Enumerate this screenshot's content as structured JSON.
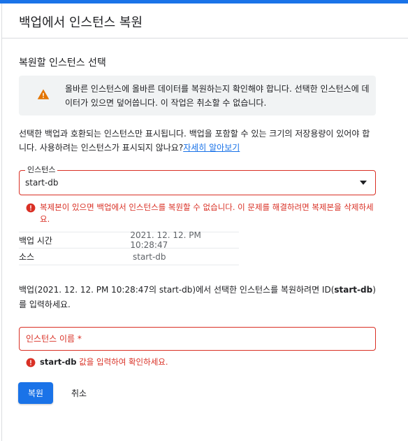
{
  "header": {
    "title": "백업에서 인스턴스 복원"
  },
  "section": {
    "title": "복원할 인스턴스 선택"
  },
  "warning": {
    "icon": "warning-icon",
    "color": "#e37400",
    "text": "올바른 인스턴스에 올바른 데이터를 복원하는지 확인해야 합니다. 선택한 인스턴스에 데이터가 있으면 덮어씁니다. 이 작업은 취소할 수 없습니다."
  },
  "info": {
    "text": "선택한 백업과 호환되는 인스턴스만 표시됩니다. 백업을 포함할 수 있는 크기의 저장용량이 있어야 합니다. 사용하려는 인스턴스가 표시되지 않나요?",
    "link": "자세히 알아보기"
  },
  "instance_select": {
    "label": "인스턴스",
    "value": "start-db",
    "error": "복제본이 있으면 백업에서 인스턴스를 복원할 수 없습니다. 이 문제를 해결하려면 복제본을 삭제하세요."
  },
  "details": {
    "rows": [
      {
        "key": "백업 시간",
        "value": "2021. 12. 12. PM 10:28:47"
      },
      {
        "key": "소스",
        "value": "start-db"
      }
    ]
  },
  "confirm": {
    "prefix": "백업(2021. 12. 12. PM 10:28:47의 start-db)에서 선택한 인스턴스를 복원하려면 ID(",
    "id": "start-db",
    "suffix": ")를 입력하세요."
  },
  "id_input": {
    "placeholder": "인스턴스 이름 *",
    "value": "",
    "error_id": "start-db",
    "error_text": " 값을 입력하여 확인하세요."
  },
  "actions": {
    "restore": "복원",
    "cancel": "취소"
  },
  "colors": {
    "accent": "#1a73e8",
    "error": "#d93025",
    "warning": "#e37400"
  }
}
